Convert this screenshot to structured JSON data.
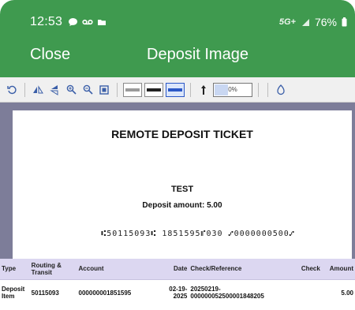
{
  "status_bar": {
    "time": "12:53",
    "network": "5G+",
    "battery": "76%"
  },
  "app_bar": {
    "close_label": "Close",
    "title": "Deposit Image"
  },
  "toolbar": {
    "zoom_value": "0%",
    "zoom_fraction": 0.35
  },
  "ticket": {
    "title": "REMOTE DEPOSIT TICKET",
    "name": "TEST",
    "amount_line": "Deposit amount: 5.00",
    "micr": "⑆50115093⑆ 1851595⑈030 ⑇0000000500⑇"
  },
  "table": {
    "headers": [
      "Type",
      "Routing & Transit",
      "Account",
      "Date",
      "Check/Reference",
      "Check",
      "Amount"
    ],
    "rows": [
      {
        "type": "Deposit Item",
        "routing": "50115093",
        "account": "000000001851595",
        "date": "02-19-2025",
        "reference": "20250219-000000052500001848205",
        "check": "",
        "amount": "5.00"
      }
    ]
  },
  "colors": {
    "header_green": "#3f9a4f",
    "table_header": "#dcd7f1",
    "viewer_bg": "#7d7d99"
  }
}
